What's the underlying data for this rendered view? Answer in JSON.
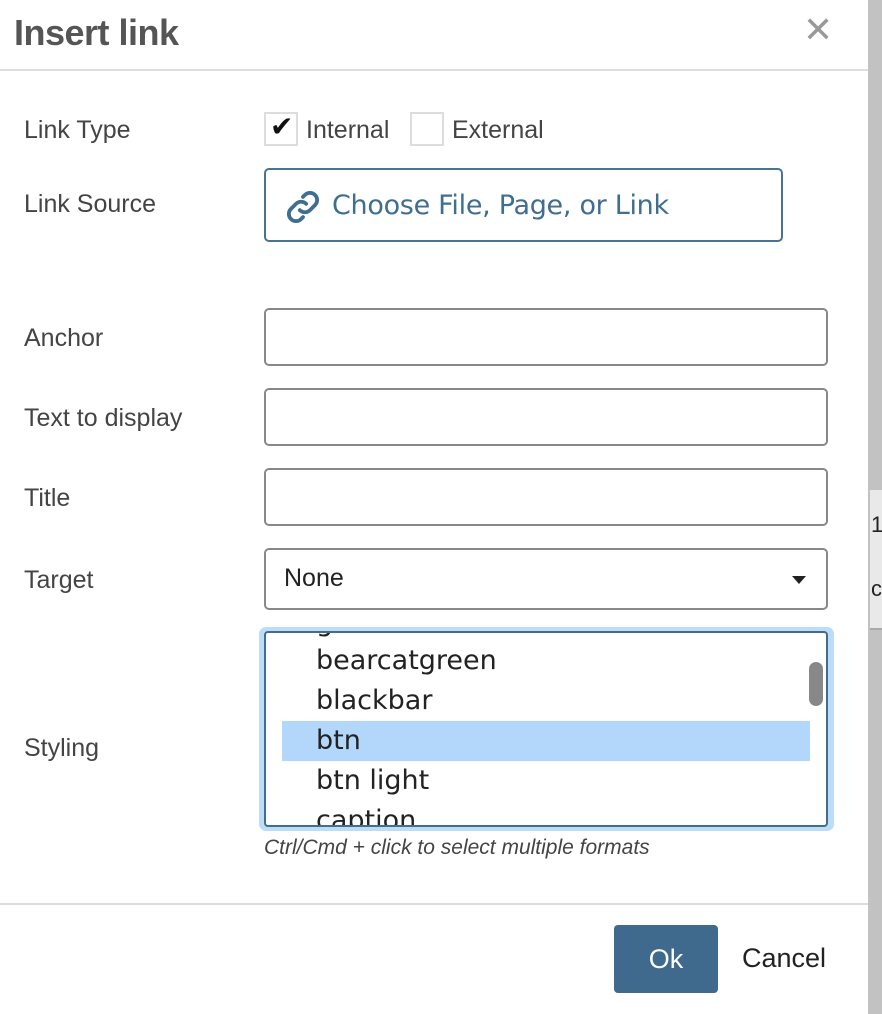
{
  "dialog": {
    "title": "Insert link",
    "close_icon": "close-x-icon"
  },
  "form": {
    "link_type_label": "Link Type",
    "internal_label": "Internal",
    "internal_checked": true,
    "external_label": "External",
    "external_checked": false,
    "link_source_label": "Link Source",
    "link_source_button": "Choose File, Page, or Link",
    "link_source_icon": "link-chain-icon",
    "anchor_label": "Anchor",
    "anchor_value": "",
    "text_label": "Text to display",
    "text_value": "",
    "title_label": "Title",
    "title_value": "",
    "target_label": "Target",
    "target_value": "None",
    "styling_label": "Styling",
    "styling_options": [
      "bearcatgreen",
      "blackbar",
      "btn",
      "btn light",
      "caption"
    ],
    "styling_selected": "btn",
    "styling_hint": "Ctrl/Cmd + click to select multiple formats"
  },
  "footer": {
    "ok_label": "Ok",
    "cancel_label": "Cancel"
  },
  "background": {
    "text1": "1",
    "text2": "c"
  },
  "colors": {
    "accent": "#3f6a8e",
    "selection": "#b3d7fb"
  }
}
